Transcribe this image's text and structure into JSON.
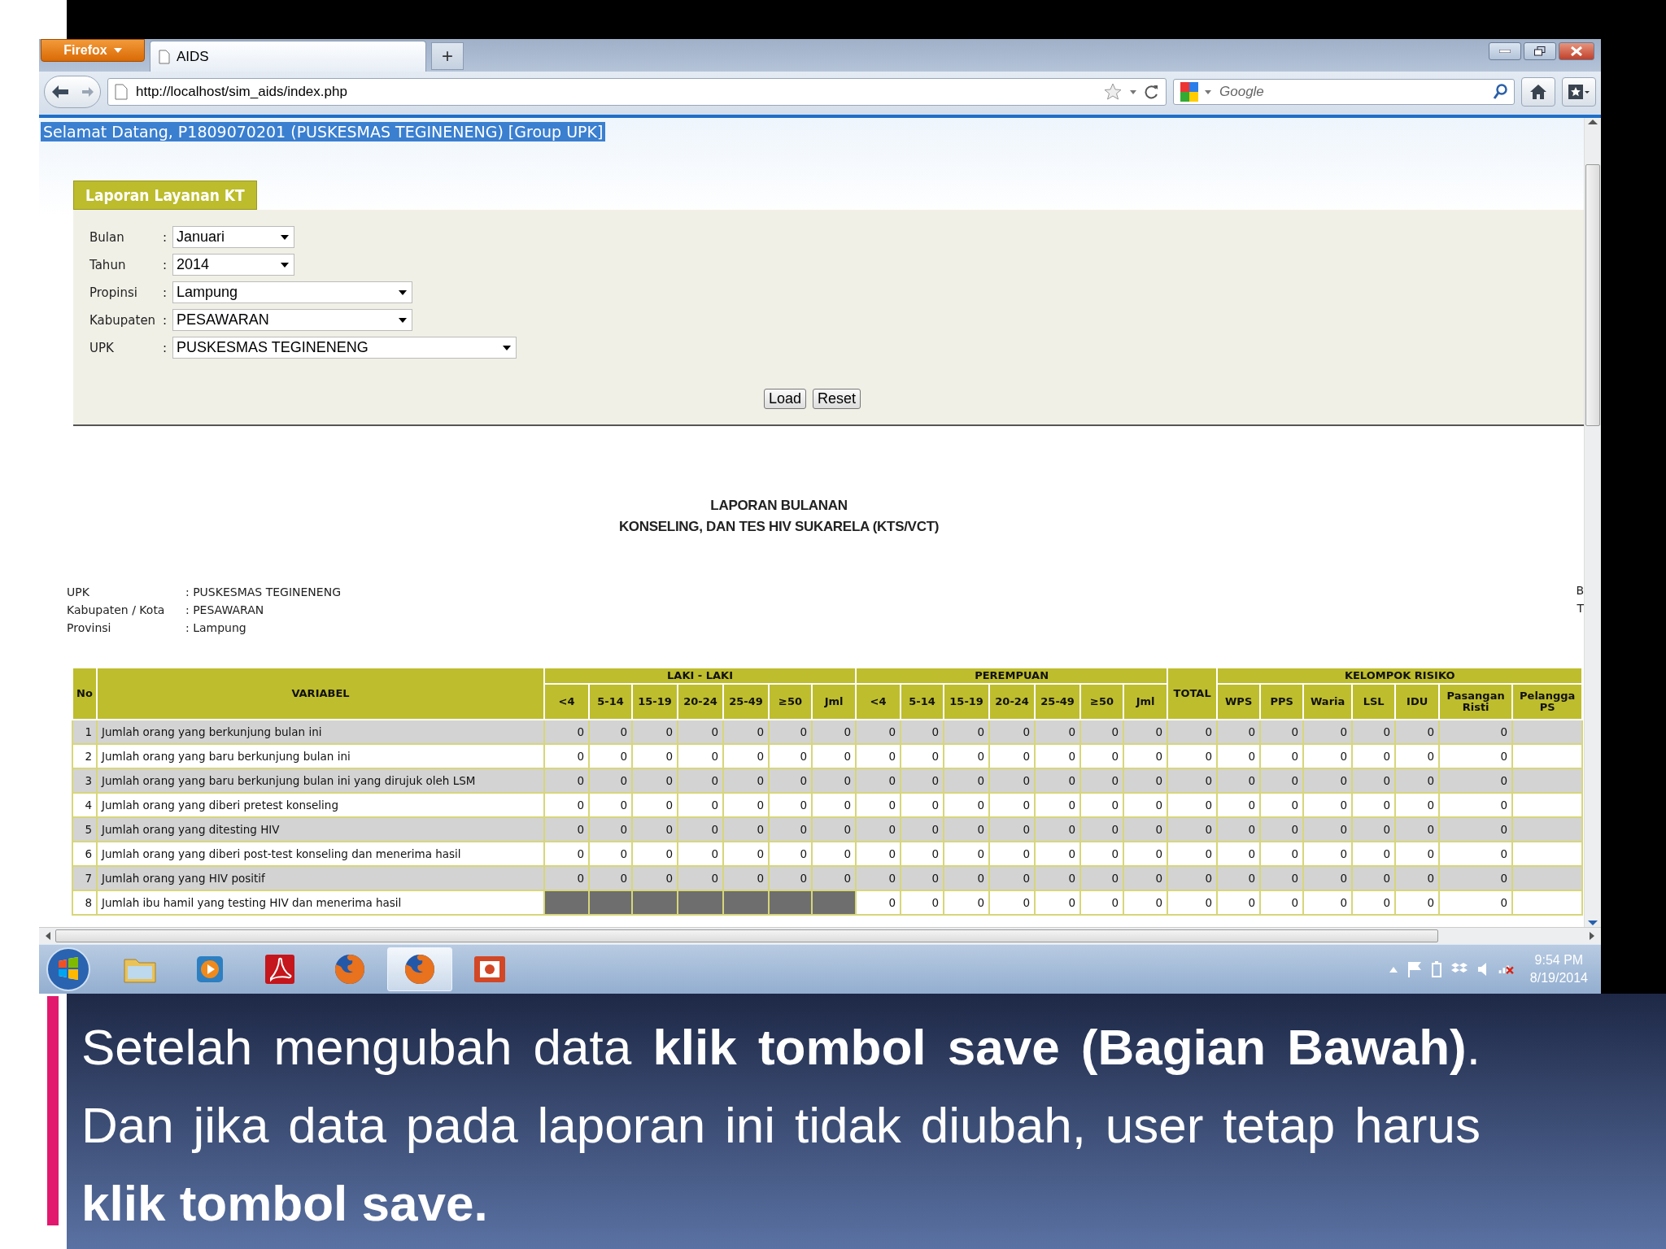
{
  "browser": {
    "menu_button": "Firefox",
    "tab_title": "AIDS",
    "new_tab": "+",
    "url": "http://localhost/sim_aids/index.php",
    "search_placeholder": "Google"
  },
  "welcome": "Selamat Datang, P1809070201 (PUSKESMAS TEGINENENG) [Group UPK]",
  "form": {
    "title": "Laporan Layanan KT",
    "fields": [
      {
        "label": "Bulan",
        "separator": ":",
        "value": "Januari"
      },
      {
        "label": "Tahun",
        "separator": ":",
        "value": "2014"
      },
      {
        "label": "Propinsi",
        "separator": ":",
        "value": "Lampung"
      },
      {
        "label": "Kabupaten",
        "separator": ":",
        "value": "PESAWARAN"
      },
      {
        "label": "UPK",
        "separator": ":",
        "value": "PUSKESMAS TEGINENENG"
      }
    ],
    "buttons": [
      "Load",
      "Reset"
    ]
  },
  "report": {
    "title_lines": [
      "LAPORAN BULANAN",
      "KONSELING, DAN TES HIV SUKARELA (KTS/VCT)"
    ],
    "info": [
      {
        "label": "UPK",
        "value": ": PUSKESMAS TEGINENENG"
      },
      {
        "label": "Kabupaten / Kota",
        "value": ": PESAWARAN"
      },
      {
        "label": "Provinsi",
        "value": ": Lampung"
      }
    ],
    "edge_texts": [
      "B",
      "T"
    ]
  },
  "table": {
    "headers": [
      {
        "kind": "single",
        "label": "No"
      },
      {
        "kind": "single",
        "label": "VARIABEL"
      },
      {
        "kind": "group",
        "label": "LAKI - LAKI",
        "columns": [
          "<4",
          "5-14",
          "15-19",
          "20-24",
          "25-49",
          "≥50",
          "Jml"
        ]
      },
      {
        "kind": "group",
        "label": "PEREMPUAN",
        "columns": [
          "<4",
          "5-14",
          "15-19",
          "20-24",
          "25-49",
          "≥50",
          "Jml"
        ]
      },
      {
        "kind": "single",
        "label": "TOTAL"
      },
      {
        "kind": "group",
        "label": "KELOMPOK RISIKO",
        "columns": [
          "WPS",
          "PPS",
          "Waria",
          "LSL",
          "IDU",
          "Pasangan Risti",
          "Pelangga PS"
        ]
      }
    ],
    "rows": [
      {
        "no": "1",
        "variabel": "Jumlah orang yang berkunjung bulan ini",
        "laki_disabled": false,
        "laki": [
          "0",
          "0",
          "0",
          "0",
          "0",
          "0",
          "0"
        ],
        "rest": [
          "0",
          "0",
          "0",
          "0",
          "0",
          "0",
          "0",
          "0",
          "0",
          "0",
          "0",
          "0",
          "0",
          "0"
        ]
      },
      {
        "no": "2",
        "variabel": "Jumlah orang yang baru berkunjung bulan ini",
        "laki_disabled": false,
        "laki": [
          "0",
          "0",
          "0",
          "0",
          "0",
          "0",
          "0"
        ],
        "rest": [
          "0",
          "0",
          "0",
          "0",
          "0",
          "0",
          "0",
          "0",
          "0",
          "0",
          "0",
          "0",
          "0",
          "0"
        ]
      },
      {
        "no": "3",
        "variabel": "Jumlah orang yang baru berkunjung bulan ini yang dirujuk oleh LSM",
        "laki_disabled": false,
        "laki": [
          "0",
          "0",
          "0",
          "0",
          "0",
          "0",
          "0"
        ],
        "rest": [
          "0",
          "0",
          "0",
          "0",
          "0",
          "0",
          "0",
          "0",
          "0",
          "0",
          "0",
          "0",
          "0",
          "0"
        ]
      },
      {
        "no": "4",
        "variabel": "Jumlah orang yang diberi pretest konseling",
        "laki_disabled": false,
        "laki": [
          "0",
          "0",
          "0",
          "0",
          "0",
          "0",
          "0"
        ],
        "rest": [
          "0",
          "0",
          "0",
          "0",
          "0",
          "0",
          "0",
          "0",
          "0",
          "0",
          "0",
          "0",
          "0",
          "0"
        ]
      },
      {
        "no": "5",
        "variabel": "Jumlah orang yang ditesting HIV",
        "laki_disabled": false,
        "laki": [
          "0",
          "0",
          "0",
          "0",
          "0",
          "0",
          "0"
        ],
        "rest": [
          "0",
          "0",
          "0",
          "0",
          "0",
          "0",
          "0",
          "0",
          "0",
          "0",
          "0",
          "0",
          "0",
          "0"
        ]
      },
      {
        "no": "6",
        "variabel": "Jumlah orang yang diberi post-test konseling dan menerima hasil",
        "laki_disabled": false,
        "laki": [
          "0",
          "0",
          "0",
          "0",
          "0",
          "0",
          "0"
        ],
        "rest": [
          "0",
          "0",
          "0",
          "0",
          "0",
          "0",
          "0",
          "0",
          "0",
          "0",
          "0",
          "0",
          "0",
          "0"
        ]
      },
      {
        "no": "7",
        "variabel": "Jumlah orang yang HIV positif",
        "laki_disabled": false,
        "laki": [
          "0",
          "0",
          "0",
          "0",
          "0",
          "0",
          "0"
        ],
        "rest": [
          "0",
          "0",
          "0",
          "0",
          "0",
          "0",
          "0",
          "0",
          "0",
          "0",
          "0",
          "0",
          "0",
          "0"
        ]
      },
      {
        "no": "8",
        "variabel": "Jumlah ibu hamil yang testing HIV dan menerima hasil",
        "laki_disabled": true,
        "rest": [
          "0",
          "0",
          "0",
          "0",
          "0",
          "0",
          "0",
          "0",
          "0",
          "0",
          "0",
          "0",
          "0",
          "0"
        ]
      }
    ]
  },
  "taskbar": {
    "items": [
      {
        "kind": "folder",
        "selected": false
      },
      {
        "kind": "media",
        "selected": false
      },
      {
        "kind": "pdf",
        "selected": false
      },
      {
        "kind": "firefox",
        "selected": false
      },
      {
        "kind": "firefox",
        "selected": true
      },
      {
        "kind": "slides",
        "selected": false
      }
    ],
    "time": "9:54 PM",
    "date": "8/19/2014"
  },
  "caption": "Setelah mengubah data **klik tombol save (Bagian Bawah)**. Dan jika data pada laporan ini tidak diubah, user tetap harus  **klik tombol save.**"
}
